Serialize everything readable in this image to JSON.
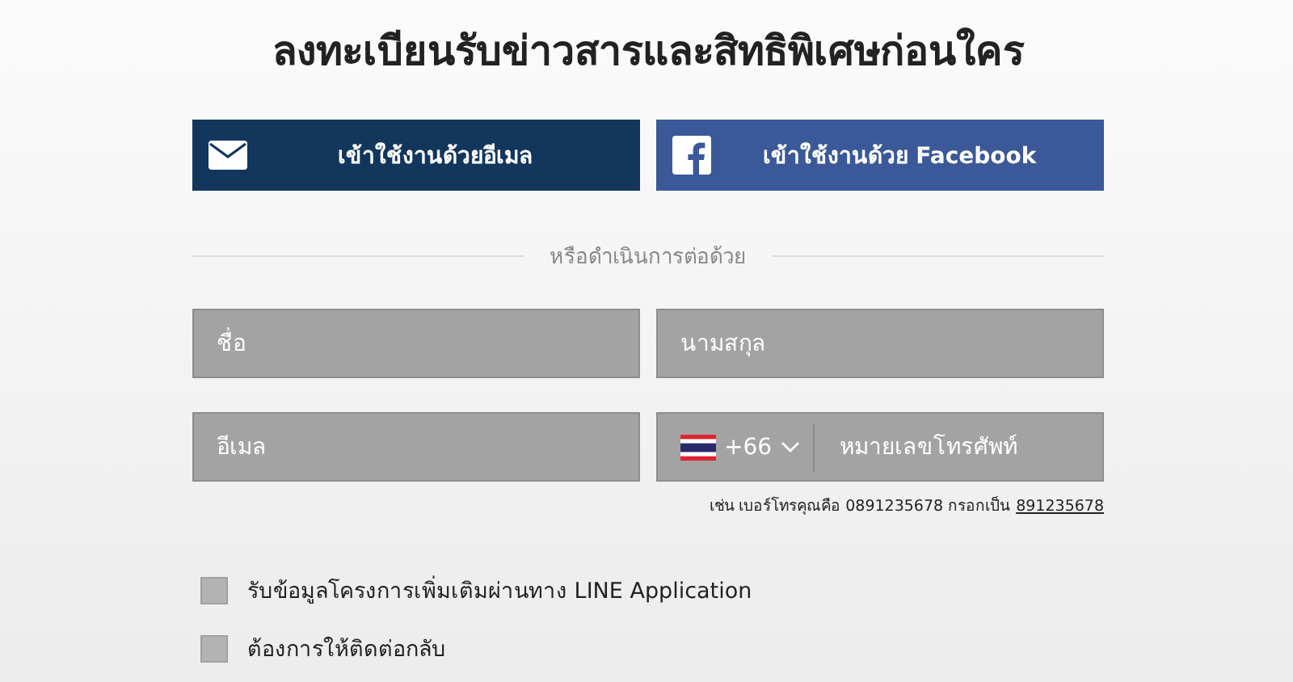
{
  "title": "ลงทะเบียนรับข่าวสารและสิทธิพิเศษก่อนใคร",
  "login_buttons": [
    {
      "kind": "email",
      "label": "เข้าใช้งานด้วยอีเมล"
    },
    {
      "kind": "facebook",
      "label": "เข้าใช้งานด้วย Facebook"
    }
  ],
  "divider_text": "หรือดำเนินการต่อด้วย",
  "fields": [
    {
      "kind": "text",
      "placeholder": "ชื่อ"
    },
    {
      "kind": "text",
      "placeholder": "นามสกุล"
    },
    {
      "kind": "text",
      "placeholder": "อีเมล"
    },
    {
      "kind": "phone",
      "country_code": "+66",
      "placeholder": "หมายเลขโทรศัพท์"
    }
  ],
  "phone_hint": {
    "text": "เช่น เบอร์โทรคุณคือ 0891235678 กรอกเป็น",
    "example": "891235678"
  },
  "checkboxes": [
    {
      "label": "รับข้อมูลโครงการเพิ่มเติมผ่านทาง LINE Application",
      "checked": false
    },
    {
      "label": "ต้องการให้ติดต่อกลับ",
      "checked": false
    }
  ]
}
